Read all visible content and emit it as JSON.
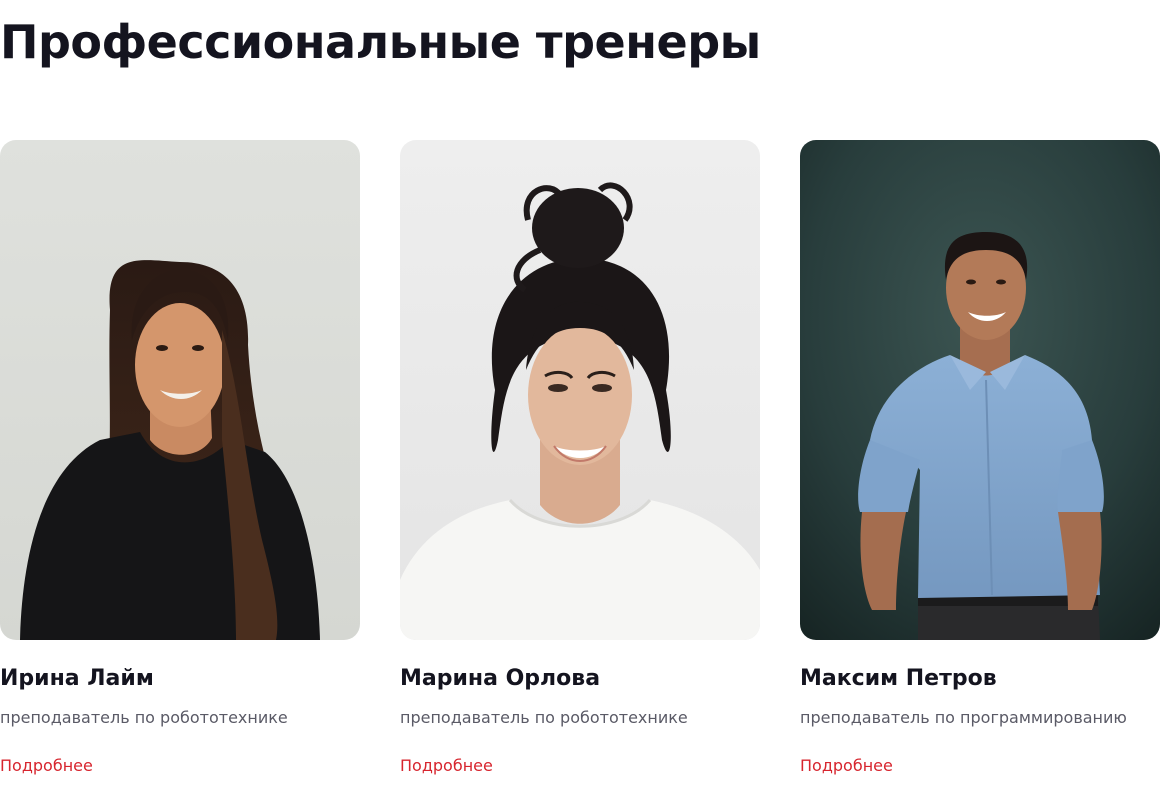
{
  "section": {
    "title": "Профессиональные тренеры"
  },
  "trainers": [
    {
      "name": "Ирина Лайм",
      "role": "преподаватель по робототехнике",
      "link": "Подробнее",
      "photo": "portrait-woman-long-dark-hair-black-top"
    },
    {
      "name": "Марина Орлова",
      "role": "преподаватель по робототехнике",
      "link": "Подробнее",
      "photo": "portrait-woman-hair-bun-white-top"
    },
    {
      "name": "Максим Петров",
      "role": "преподаватель по программированию",
      "link": "Подробнее",
      "photo": "portrait-man-blue-shirt-dark-background"
    }
  ],
  "colors": {
    "title": "#14141f",
    "role_text": "#5a5a66",
    "link": "#d7252e"
  }
}
